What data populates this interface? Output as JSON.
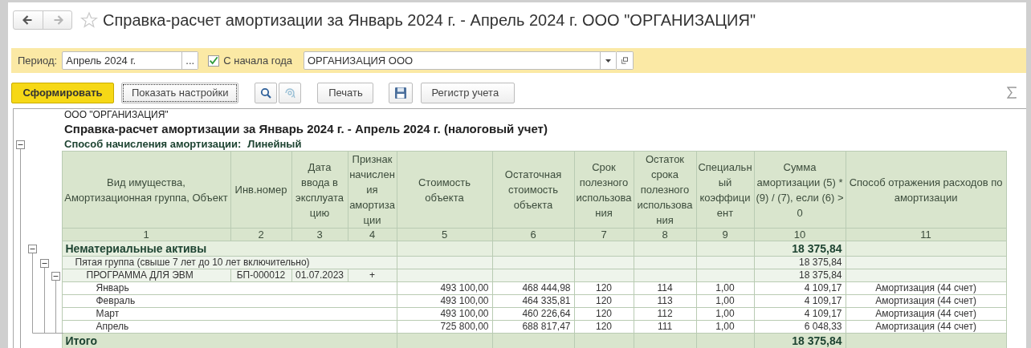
{
  "window": {
    "title": "Справка-расчет амортизации за Январь 2024 г. - Апрель 2024 г. ООО \"ОРГАНИЗАЦИЯ\"",
    "back": {
      "disabled": false
    },
    "forward": {
      "disabled": true
    }
  },
  "filters": {
    "period_label": "Период:",
    "period": "Апрель 2024 г.",
    "period_button": "...",
    "from_year_start": {
      "label": "С начала года",
      "checked": true
    },
    "organization": "ОРГАНИЗАЦИЯ ООО"
  },
  "toolbar": {
    "generate": "Сформировать",
    "settings": "Показать настройки",
    "print": "Печать",
    "register": "Регистр учета"
  },
  "report": {
    "organization": "ООО \"ОРГАНИЗАЦИЯ\"",
    "title": "Справка-расчет амортизации за Январь 2024 г. - Апрель 2024 г. (налоговый учет)",
    "method_label": "Способ начисления амортизации:",
    "method": "Линейный",
    "expanded": true,
    "columns": [
      {
        "title": "Вид имущества, Амортизационная группа, Объект",
        "number": "1"
      },
      {
        "title": "Инв.номер",
        "number": "2"
      },
      {
        "title": "Дата ввода в эксплуатацию",
        "number": "3"
      },
      {
        "title": "Признак начисления амортизации",
        "number": "4"
      },
      {
        "title": "Стоимость объекта",
        "number": "5"
      },
      {
        "title": "Остаточная стоимость объекта",
        "number": "6"
      },
      {
        "title": "Срок полезного использования",
        "number": "7"
      },
      {
        "title": "Остаток срока полезного использования",
        "number": "8"
      },
      {
        "title": "Специальный коэффициент",
        "number": "9"
      },
      {
        "title": "Сумма амортизации (5) * (9) / (7), если (6) > 0",
        "number": "10"
      },
      {
        "title": "Способ отражения расходов по амортизации",
        "number": "11"
      }
    ],
    "rows": [
      {
        "kind": "section",
        "label": "Нематериальные активы",
        "amount": "18 375,84",
        "expanded": true,
        "children": [
          {
            "kind": "group",
            "label": "Пятая группа (свыше 7 лет до 10 лет включительно)",
            "amount": "18 375,84",
            "expanded": true,
            "children": [
              {
                "kind": "object",
                "label": "ПРОГРАММА ДЛЯ ЭВМ",
                "inventory_number": "БП-000012",
                "commissioning_date": "01.07.2023",
                "accrual_flag": "+",
                "amount": "18 375,84",
                "expanded": true,
                "children": [
                  {
                    "kind": "period",
                    "label": "Январь",
                    "cost": "493 100,00",
                    "residual_cost": "468 444,98",
                    "useful_life": "120",
                    "remaining_life": "114",
                    "coefficient": "1,00",
                    "amount": "4 109,17",
                    "expense_method": "Амортизация (44 счет)"
                  },
                  {
                    "kind": "period",
                    "label": "Февраль",
                    "cost": "493 100,00",
                    "residual_cost": "464 335,81",
                    "useful_life": "120",
                    "remaining_life": "113",
                    "coefficient": "1,00",
                    "amount": "4 109,17",
                    "expense_method": "Амортизация (44 счет)"
                  },
                  {
                    "kind": "period",
                    "label": "Март",
                    "cost": "493 100,00",
                    "residual_cost": "460 226,64",
                    "useful_life": "120",
                    "remaining_life": "112",
                    "coefficient": "1,00",
                    "amount": "4 109,17",
                    "expense_method": "Амортизация (44 счет)"
                  },
                  {
                    "kind": "period",
                    "label": "Апрель",
                    "cost": "725 800,00",
                    "residual_cost": "688 817,47",
                    "useful_life": "120",
                    "remaining_life": "111",
                    "coefficient": "1,00",
                    "amount": "6 048,33",
                    "expense_method": "Амортизация (44 счет)"
                  }
                ]
              }
            ]
          }
        ]
      }
    ],
    "total": {
      "label": "Итого",
      "amount": "18 375,84"
    }
  }
}
